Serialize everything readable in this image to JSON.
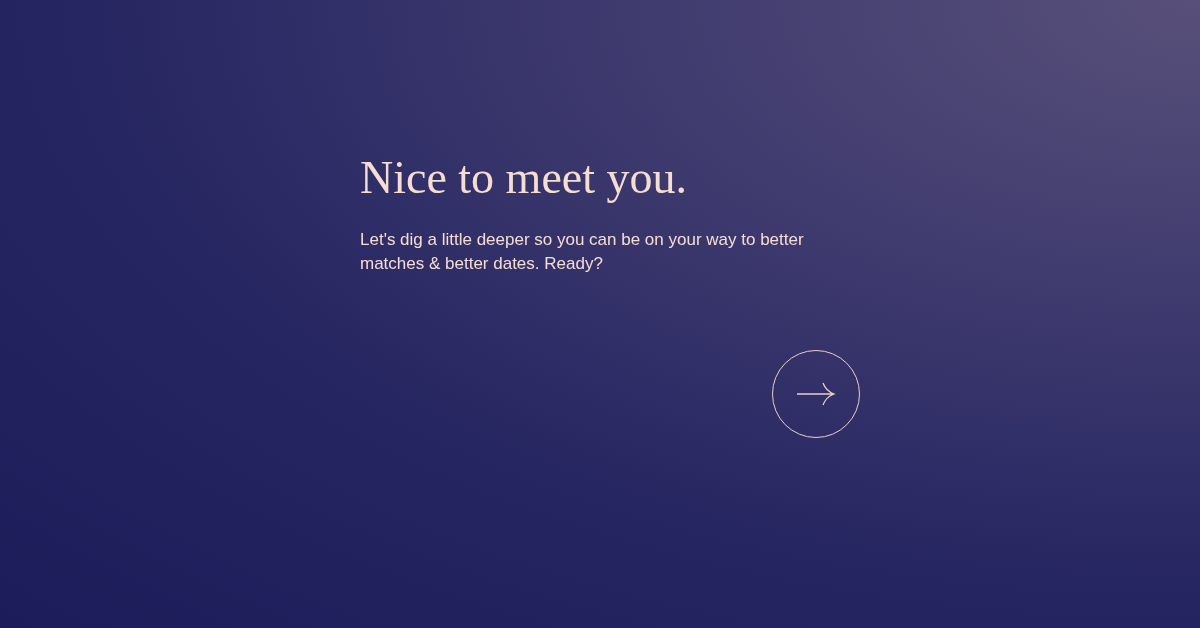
{
  "heading": "Nice to meet you.",
  "body": "Let's dig a little deeper so you can be on your way to better matches & better dates. Ready?"
}
